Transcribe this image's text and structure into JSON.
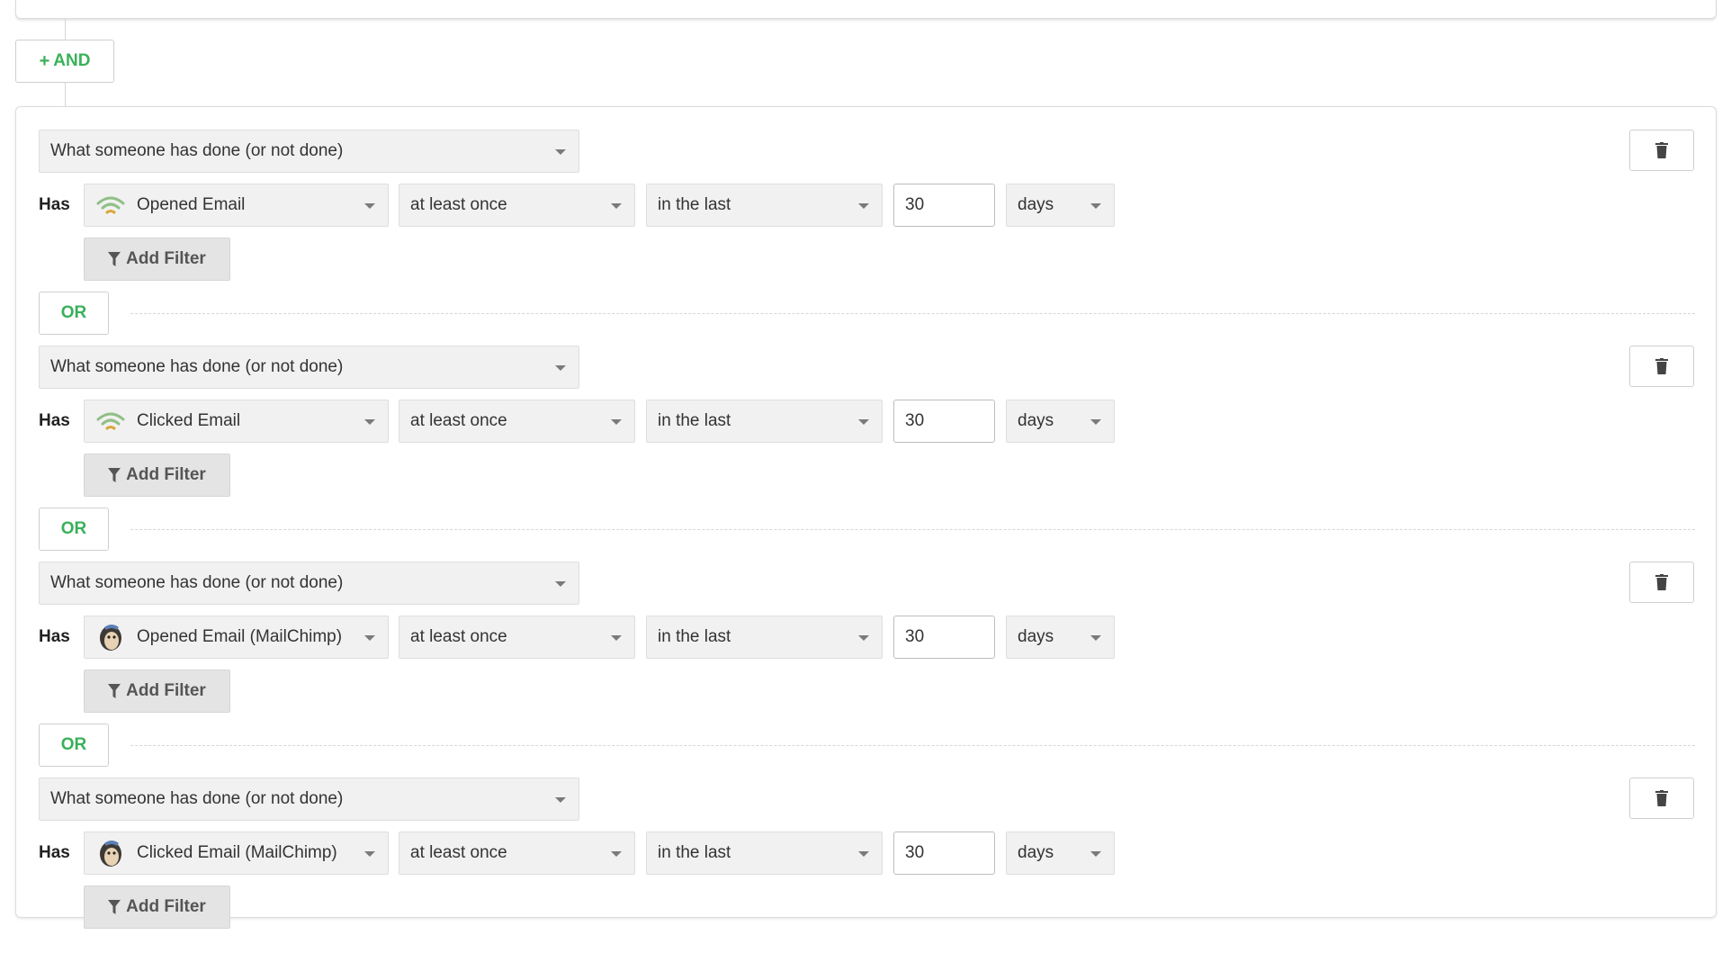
{
  "and_button": {
    "label": "AND"
  },
  "or_label": "OR",
  "add_filter_label": "Add Filter",
  "has_label": "Has",
  "conditions": [
    {
      "type": "What someone has done (or not done)",
      "metric": "Opened Email",
      "metric_icon": "wifi-signal-icon",
      "frequency": "at least once",
      "range": "in the last",
      "count": "30",
      "unit": "days"
    },
    {
      "type": "What someone has done (or not done)",
      "metric": "Clicked Email",
      "metric_icon": "wifi-signal-icon",
      "frequency": "at least once",
      "range": "in the last",
      "count": "30",
      "unit": "days"
    },
    {
      "type": "What someone has done (or not done)",
      "metric": "Opened Email (MailChimp)",
      "metric_icon": "mailchimp-icon",
      "frequency": "at least once",
      "range": "in the last",
      "count": "30",
      "unit": "days"
    },
    {
      "type": "What someone has done (or not done)",
      "metric": "Clicked Email (MailChimp)",
      "metric_icon": "mailchimp-icon",
      "frequency": "at least once",
      "range": "in the last",
      "count": "30",
      "unit": "days"
    }
  ],
  "colors": {
    "accent_green": "#3ab05a",
    "select_bg": "#f1f1f1",
    "button_bg": "#e4e4e4"
  }
}
